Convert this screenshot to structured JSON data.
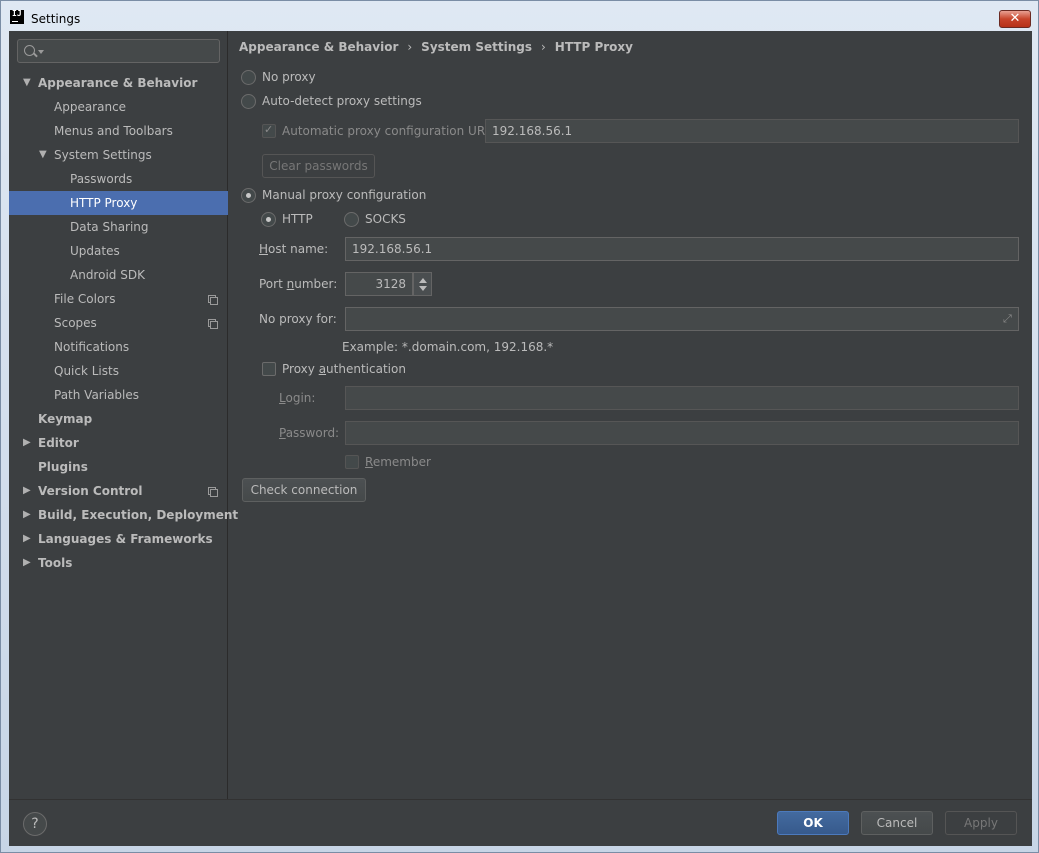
{
  "window": {
    "title": "Settings",
    "app_icon_text": "IJ",
    "close_symbol": "✕"
  },
  "search": {
    "placeholder": "",
    "icon": "search-icon"
  },
  "sidebar": {
    "items": [
      {
        "label": "Appearance & Behavior",
        "expanded": true
      },
      {
        "label": "Appearance"
      },
      {
        "label": "Menus and Toolbars"
      },
      {
        "label": "System Settings",
        "expanded": true
      },
      {
        "label": "Passwords"
      },
      {
        "label": "HTTP Proxy",
        "selected": true
      },
      {
        "label": "Data Sharing"
      },
      {
        "label": "Updates"
      },
      {
        "label": "Android SDK"
      },
      {
        "label": "File Colors",
        "icon": "copy-icon"
      },
      {
        "label": "Scopes",
        "icon": "copy-icon"
      },
      {
        "label": "Notifications"
      },
      {
        "label": "Quick Lists"
      },
      {
        "label": "Path Variables"
      },
      {
        "label": "Keymap"
      },
      {
        "label": "Editor",
        "expanded": false
      },
      {
        "label": "Plugins"
      },
      {
        "label": "Version Control",
        "expanded": false,
        "icon": "copy-icon"
      },
      {
        "label": "Build, Execution, Deployment",
        "expanded": false
      },
      {
        "label": "Languages & Frameworks",
        "expanded": false
      },
      {
        "label": "Tools",
        "expanded": false
      }
    ],
    "expanded_arrow": "▼",
    "collapsed_arrow": "▶"
  },
  "breadcrumb": [
    "Appearance & Behavior",
    "System Settings",
    "HTTP Proxy"
  ],
  "breadcrumb_sep": "›",
  "proxy": {
    "no_proxy": "No proxy",
    "auto_detect": "Auto-detect proxy settings",
    "auto_config_url_label": "Automatic proxy configuration URL:",
    "auto_config_url_value": "192.168.56.1",
    "clear_passwords": "Clear passwords",
    "manual": "Manual proxy configuration",
    "http": "HTTP",
    "socks": "SOCKS",
    "host_label_u": "H",
    "host_label_rest": "ost name:",
    "host_value": "192.168.56.1",
    "port_label_pre": "Port ",
    "port_label_u": "n",
    "port_label_rest": "umber:",
    "port_value": "3128",
    "no_proxy_for_label": "No proxy for:",
    "no_proxy_for_value": "",
    "example": "Example: *.domain.com, 192.168.*",
    "auth_pre": "Proxy ",
    "auth_u": "a",
    "auth_rest": "uthentication",
    "login_u": "L",
    "login_rest": "ogin:",
    "login_value": "",
    "password_u": "P",
    "password_rest": "assword:",
    "password_value": "",
    "remember_u": "R",
    "remember_rest": "emember",
    "check_connection": "Check connection",
    "selected_mode": "manual",
    "selected_protocol": "HTTP"
  },
  "footer": {
    "help": "?",
    "ok": "OK",
    "cancel": "Cancel",
    "apply": "Apply"
  },
  "colors": {
    "background": "#3c3f41",
    "selection": "#4b6eaf",
    "text": "#bbbbbb",
    "ok_button": "#375a8c"
  }
}
